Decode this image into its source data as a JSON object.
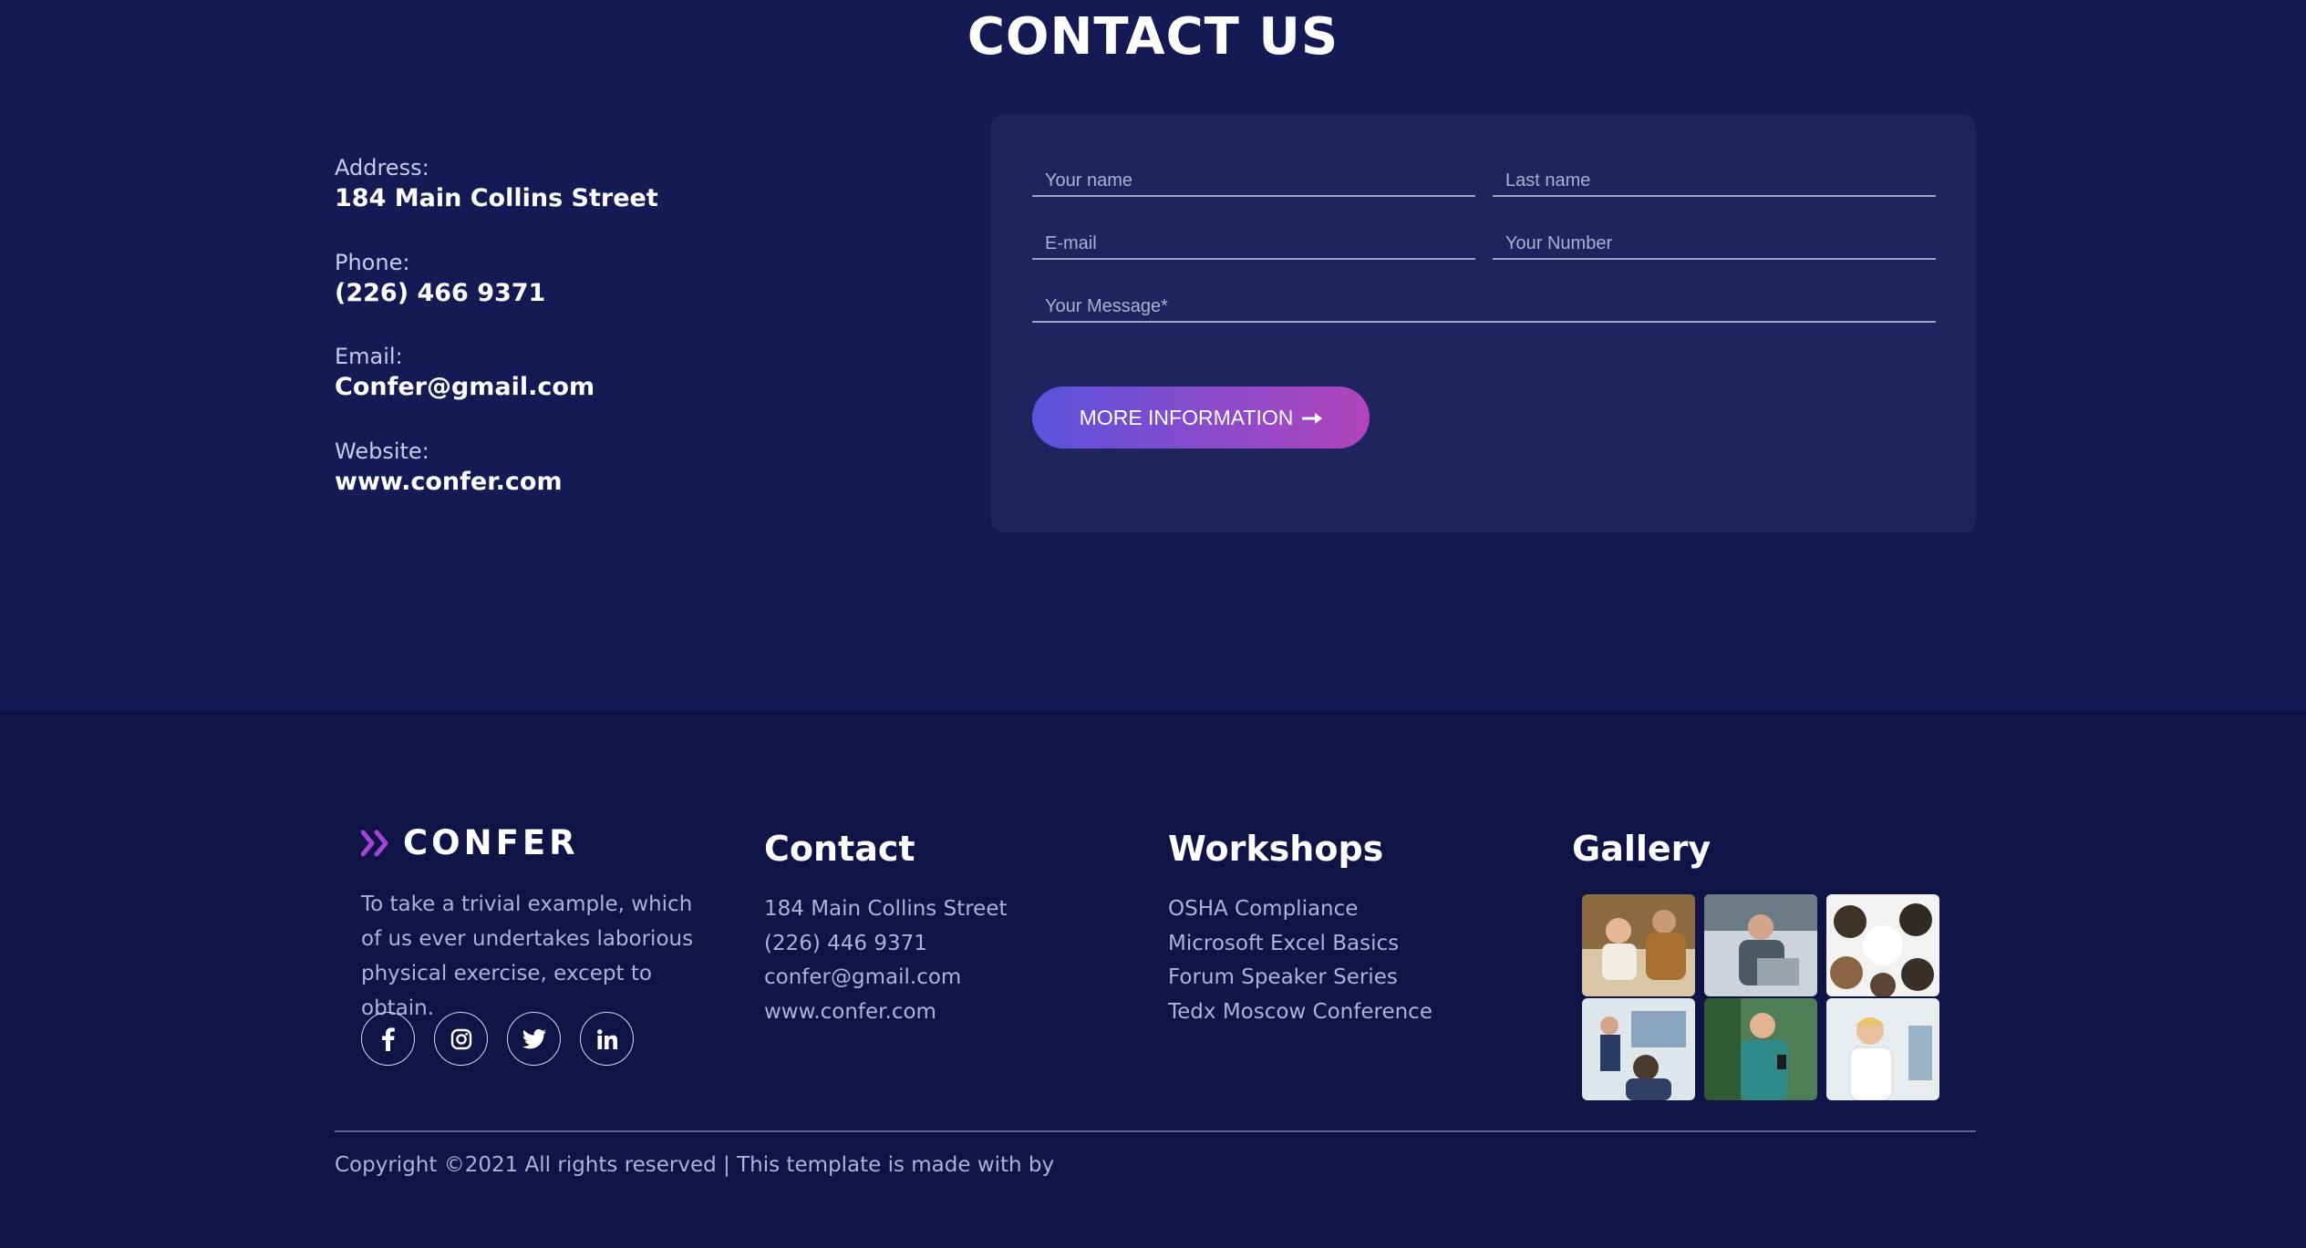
{
  "contact": {
    "title": "CONTACT US",
    "address_label": "Address:",
    "address_value": "184 Main Collins Street",
    "phone_label": "Phone:",
    "phone_value": "(226) 466 9371",
    "email_label": "Email:",
    "email_value": "Confer@gmail.com",
    "website_label": "Website:",
    "website_value": "www.confer.com"
  },
  "form": {
    "first_name_placeholder": "Your name",
    "last_name_placeholder": "Last name",
    "email_placeholder": "E-mail",
    "number_placeholder": "Your Number",
    "message_placeholder": "Your Message*",
    "submit_label": "MORE INFORMATION",
    "submit_icon": "arrow-right-icon"
  },
  "footer": {
    "brand_name": "CONFER",
    "about": "To take a trivial example, which of us ever undertakes laborious physical exercise, except to obtain.",
    "social": [
      "facebook-icon",
      "instagram-icon",
      "twitter-icon",
      "linkedin-icon"
    ],
    "contact_title": "Contact",
    "contact_items": [
      "184 Main Collins Street",
      "(226) 446 9371",
      "confer@gmail.com",
      "www.confer.com"
    ],
    "workshops_title": "Workshops",
    "workshop_items": [
      "OSHA Compliance",
      "Microsoft Excel Basics",
      "Forum Speaker Series",
      "Tedx Moscow Conference"
    ],
    "gallery_title": "Gallery",
    "gallery": [
      "meeting-photo",
      "laptop-worker-photo",
      "team-huddle-photo",
      "presentation-photo",
      "phone-user-photo",
      "office-worker-photo"
    ],
    "copyright": "Copyright ©2021 All rights reserved | This template is made with by"
  },
  "colors": {
    "background": "#151a54",
    "footer_background": "#101346",
    "card": "#20245e",
    "button_gradient_start": "#5a52dc",
    "button_gradient_end": "#b244bc",
    "brand_accent": "#a146d8"
  }
}
